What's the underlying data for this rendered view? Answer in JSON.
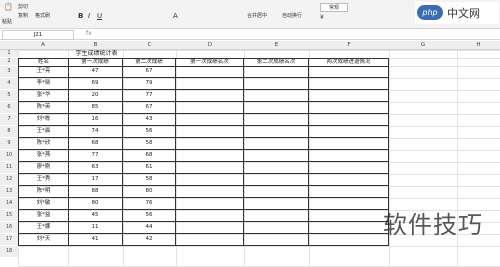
{
  "toolbar": {
    "paste": "粘贴",
    "cut": "剪切",
    "copy": "复制",
    "format_painter": "格式刷",
    "bold": "B",
    "italic": "I",
    "underline": "U",
    "merge_center": "合并居中",
    "wrap_text": "自动换行",
    "number_format": "常规",
    "font_size_a": "A",
    "currency": "¥"
  },
  "formula_bar": {
    "name_box": "J21",
    "fx": "fx"
  },
  "columns": [
    "A",
    "B",
    "C",
    "D",
    "E",
    "F",
    "G",
    "H"
  ],
  "rows": [
    "1",
    "2",
    "3",
    "4",
    "5",
    "6",
    "7",
    "8",
    "9",
    "10",
    "11",
    "12",
    "13",
    "14",
    "15",
    "16",
    "17",
    "18"
  ],
  "sheet": {
    "title": "学生成绩统计表",
    "headers": [
      "姓名",
      "第一次成绩",
      "第二次成绩",
      "第一次成绩名次",
      "第二次成绩名次",
      "两次成绩进退情况"
    ],
    "records": [
      {
        "name": "王*亮",
        "s1": "47",
        "s2": "67"
      },
      {
        "name": "李*晓",
        "s1": "69",
        "s2": "79"
      },
      {
        "name": "张*华",
        "s1": "20",
        "s2": "77"
      },
      {
        "name": "陈*英",
        "s1": "85",
        "s2": "67"
      },
      {
        "name": "刘*栋",
        "s1": "16",
        "s2": "43"
      },
      {
        "name": "王*晨",
        "s1": "74",
        "s2": "56"
      },
      {
        "name": "陈*欣",
        "s1": "68",
        "s2": "58"
      },
      {
        "name": "张*燕",
        "s1": "77",
        "s2": "68"
      },
      {
        "name": "廖*刚",
        "s1": "63",
        "s2": "61"
      },
      {
        "name": "王*秀",
        "s1": "17",
        "s2": "58"
      },
      {
        "name": "陈*明",
        "s1": "88",
        "s2": "80"
      },
      {
        "name": "刘*敏",
        "s1": "80",
        "s2": "76"
      },
      {
        "name": "张*益",
        "s1": "45",
        "s2": "56"
      },
      {
        "name": "王*娜",
        "s1": "11",
        "s2": "44"
      },
      {
        "name": "刘*天",
        "s1": "41",
        "s2": "42"
      }
    ]
  },
  "watermark": {
    "php": "php",
    "site": "中文网",
    "tips": "软件技巧"
  }
}
